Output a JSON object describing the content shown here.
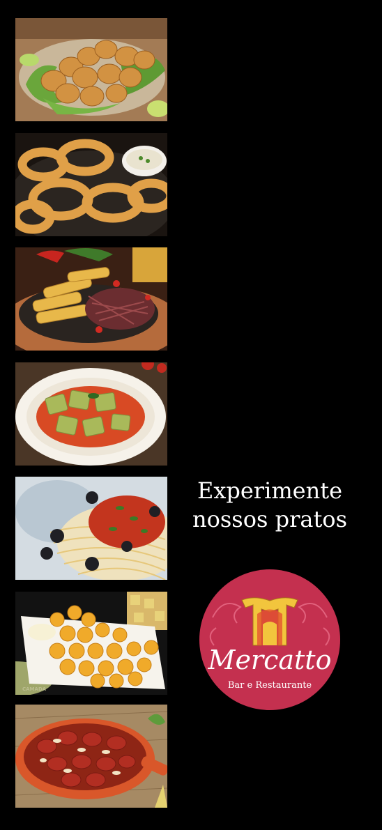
{
  "headline": {
    "line1": "Experimente",
    "line2": "nossos pratos"
  },
  "logo": {
    "brand": "Mercatto",
    "subtitle": "Bar e Restaurante",
    "color": "#c4304f",
    "accent": "#f2c53d"
  },
  "gallery": [
    {
      "name": "fried-chicken-bites-photo"
    },
    {
      "name": "onion-rings-photo"
    },
    {
      "name": "jerked-beef-cassava-photo"
    },
    {
      "name": "ravioli-tomato-sauce-photo"
    },
    {
      "name": "spaghetti-olives-photo"
    },
    {
      "name": "cheese-balls-photo"
    },
    {
      "name": "sausage-onion-skillet-photo"
    }
  ],
  "watermark": "CAMADA"
}
